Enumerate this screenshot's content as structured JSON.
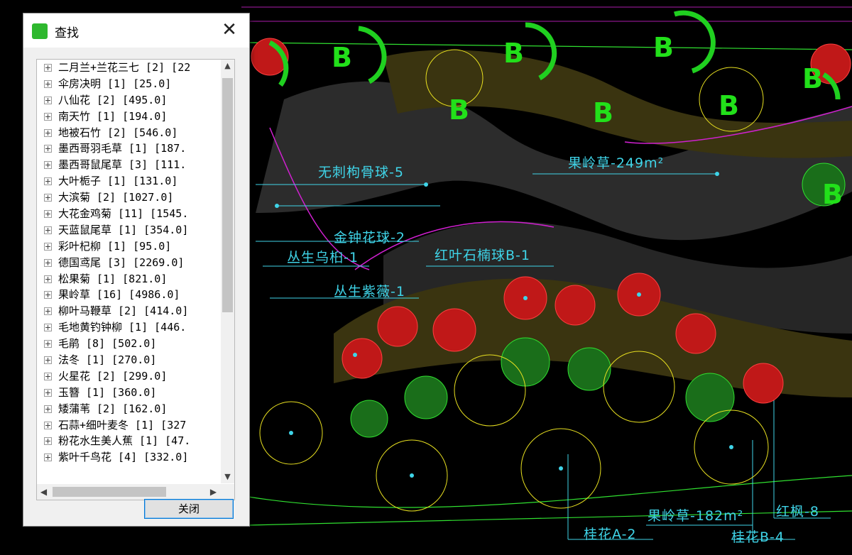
{
  "dialog": {
    "title": "查找",
    "close_button_label": "关闭",
    "items": [
      "二月兰+兰花三七 [2] [22",
      "伞房决明 [1] [25.0]",
      "八仙花 [2] [495.0]",
      "南天竹 [1] [194.0]",
      "地被石竹 [2] [546.0]",
      "墨西哥羽毛草 [1] [187.",
      "墨西哥鼠尾草 [3] [111.",
      "大叶栀子 [1] [131.0]",
      "大滨菊 [2] [1027.0]",
      "大花金鸡菊 [11] [1545.",
      "天蓝鼠尾草 [1] [354.0]",
      "彩叶杞柳 [1] [95.0]",
      "德国鸢尾 [3] [2269.0]",
      "松果菊 [1] [821.0]",
      "果岭草 [16] [4986.0]",
      "柳叶马鞭草 [2] [414.0]",
      "毛地黄钓钟柳 [1] [446.",
      "毛鹃 [8] [502.0]",
      "法冬 [1] [270.0]",
      "火星花 [2] [299.0]",
      "玉簪 [1] [360.0]",
      "矮蒲苇 [2] [162.0]",
      "石蒜+细叶麦冬 [1] [327",
      "粉花水生美人蕉 [1] [47.",
      "紫叶千鸟花 [4] [332.0]"
    ]
  },
  "drawing": {
    "labels": [
      "无刺枸骨球-5",
      "果岭草-249m²",
      "金钟花球-2",
      "丛生乌桕-1",
      "红叶石楠球B-1",
      "丛生紫薇-1",
      "果岭草-182m²",
      "红枫-8",
      "桂花A-2",
      "桂花B-4"
    ],
    "letters": [
      "B",
      "B",
      "B",
      "B",
      "B",
      "B",
      "B",
      "B"
    ]
  }
}
